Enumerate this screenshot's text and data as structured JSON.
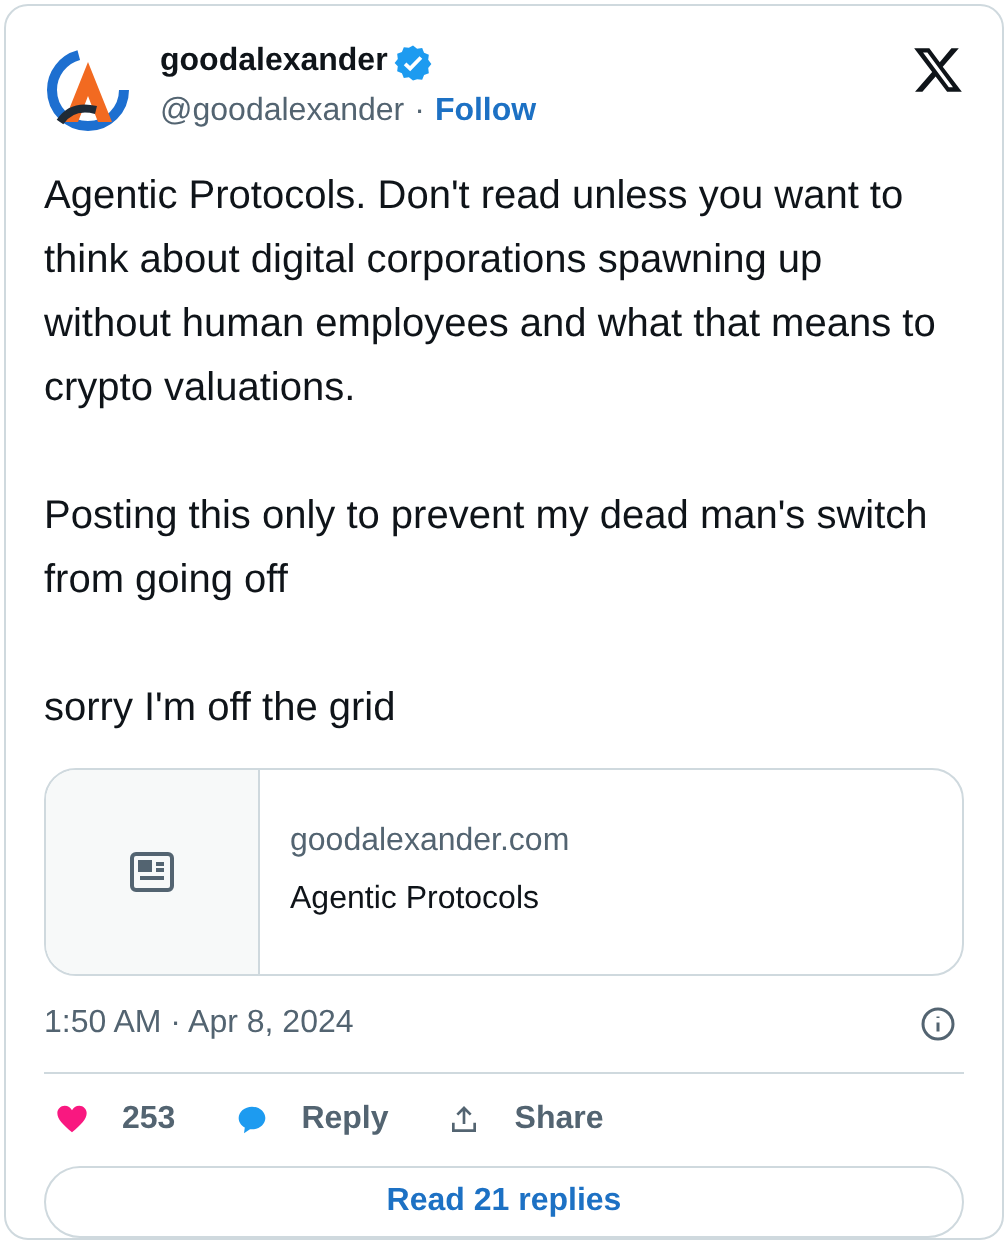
{
  "author": {
    "name": "goodalexander",
    "verified": true,
    "handle": "@goodalexander",
    "separator": "·",
    "follow": "Follow"
  },
  "paragraphs": [
    "Agentic Protocols. Don't read unless you want to think about digital corporations spawning up without human employees and what that means to crypto valuations.",
    "Posting this only to prevent my dead man's switch from going off",
    "sorry I'm off the grid"
  ],
  "link_card": {
    "domain": "goodalexander.com",
    "title": "Agentic Protocols"
  },
  "timestamp": "1:50 AM · Apr 8, 2024",
  "actions": [
    {
      "kind": "like",
      "label": "253"
    },
    {
      "kind": "reply",
      "label": "Reply"
    },
    {
      "kind": "share",
      "label": "Share"
    }
  ],
  "read_replies": "Read 21 replies"
}
